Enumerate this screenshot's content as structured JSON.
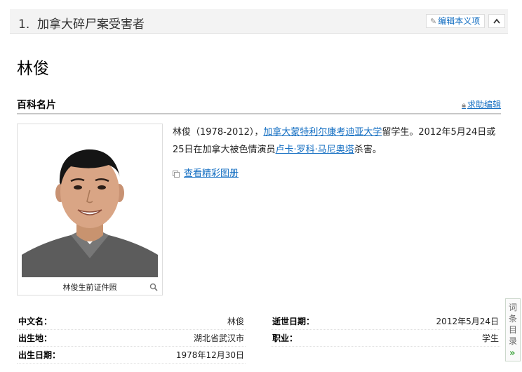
{
  "section": {
    "number": "1.",
    "title": "加拿大碎尸案受害者",
    "edit_label": "编辑本义项"
  },
  "person": {
    "name": "林俊"
  },
  "card": {
    "title": "百科名片",
    "help_edit": "求助编辑",
    "photo_caption": "林俊生前证件照",
    "summary": {
      "t1": "林俊（1978-2012），",
      "link_university": "加拿大蒙特利尔康考迪亚大学",
      "t2": "留学生。2012年5月24日或25日在加拿大被色情演员",
      "link_murderer": "卢卡·罗科·马尼奥塔",
      "t3": "杀害。"
    },
    "album_link": "查看精彩图册"
  },
  "info": {
    "left": [
      {
        "key": "中文名：",
        "value": "林俊"
      },
      {
        "key": "出生地：",
        "value": "湖北省武汉市"
      },
      {
        "key": "出生日期：",
        "value": "1978年12月30日"
      }
    ],
    "right": [
      {
        "key": "逝世日期：",
        "value": "2012年5月24日"
      },
      {
        "key": "职业：",
        "value": "学生"
      }
    ]
  },
  "side_directory": {
    "label": "词条目录",
    "arrow": "»"
  }
}
